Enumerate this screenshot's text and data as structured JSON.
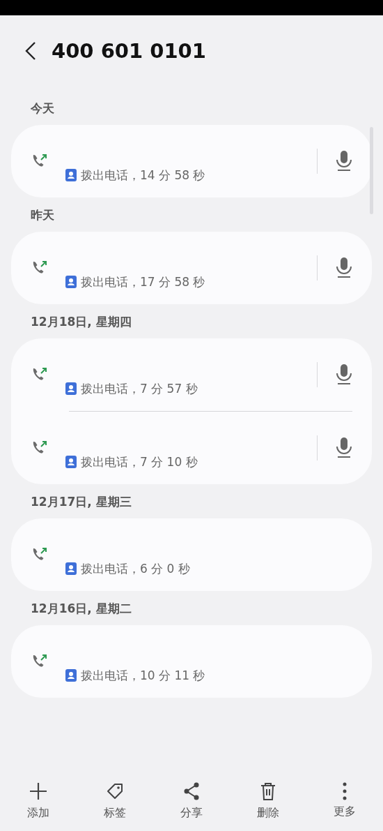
{
  "header": {
    "title": "400 601 0101"
  },
  "groups": [
    {
      "date": "今天",
      "calls": [
        {
          "detail": "拨出电话，14 分 58 秒",
          "has_recording": true
        }
      ]
    },
    {
      "date": "昨天",
      "calls": [
        {
          "detail": "拨出电话，17 分 58 秒",
          "has_recording": true
        }
      ]
    },
    {
      "date": "12月18日, 星期四",
      "calls": [
        {
          "detail": "拨出电话，7 分 57 秒",
          "has_recording": true
        },
        {
          "detail": "拨出电话，7 分 10 秒",
          "has_recording": true
        }
      ]
    },
    {
      "date": "12月17日, 星期三",
      "calls": [
        {
          "detail": "拨出电话，6 分 0 秒",
          "has_recording": false
        }
      ]
    },
    {
      "date": "12月16日, 星期二",
      "calls": [
        {
          "detail": "拨出电话，10 分 11 秒",
          "has_recording": false
        }
      ]
    }
  ],
  "toolbar": [
    {
      "label": "添加",
      "kind": "add"
    },
    {
      "label": "标签",
      "kind": "tag"
    },
    {
      "label": "分享",
      "kind": "share"
    },
    {
      "label": "删除",
      "kind": "delete"
    },
    {
      "label": "更多",
      "kind": "more"
    }
  ]
}
